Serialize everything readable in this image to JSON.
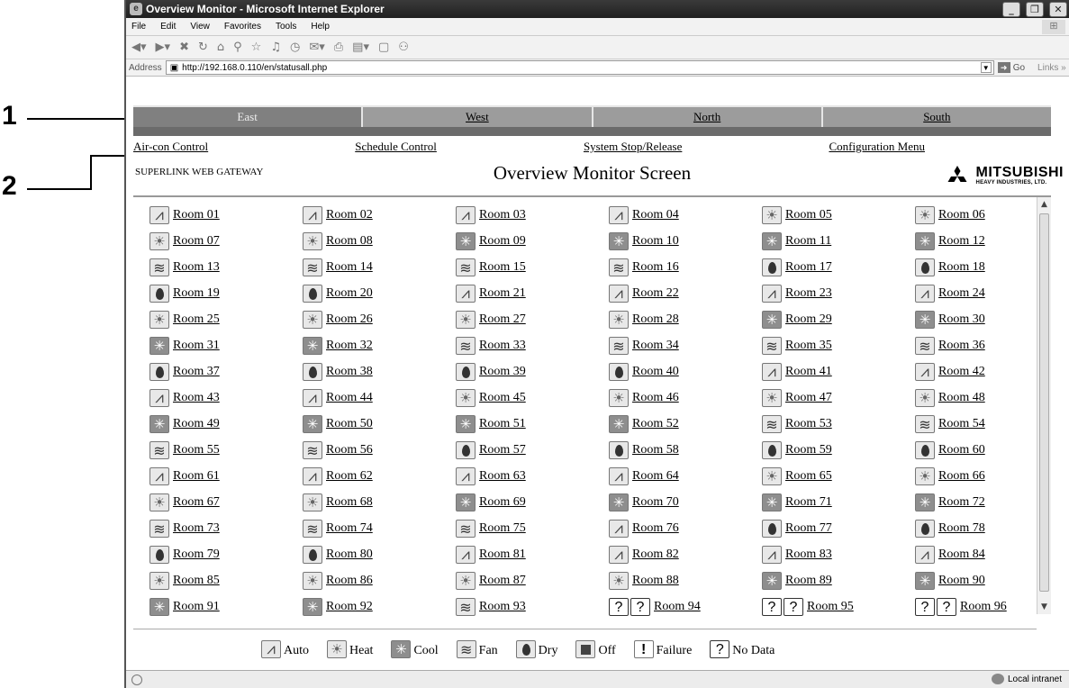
{
  "callouts": [
    "1",
    "2"
  ],
  "window": {
    "title": "Overview Monitor - Microsoft Internet Explorer",
    "menu": [
      "File",
      "Edit",
      "View",
      "Favorites",
      "Tools",
      "Help"
    ],
    "address_label": "Address",
    "url": "http://192.168.0.110/en/statusall.php",
    "go_label": "Go",
    "links_label": "Links",
    "status_zone": "Local intranet"
  },
  "nav": {
    "tabs": [
      "East",
      "West",
      "North",
      "South"
    ],
    "active_tab": "East",
    "menu_links": [
      "Air-con Control",
      "Schedule Control",
      "System Stop/Release",
      "Configuration Menu"
    ]
  },
  "header": {
    "gateway": "SUPERLINK WEB GATEWAY",
    "title": "Overview Monitor Screen",
    "logo_main": "MITSUBISHI",
    "logo_sub": "HEAVY INDUSTRIES, LTD."
  },
  "rooms": [
    {
      "name": "Room 01",
      "mode": "auto"
    },
    {
      "name": "Room 02",
      "mode": "auto"
    },
    {
      "name": "Room 03",
      "mode": "auto"
    },
    {
      "name": "Room 04",
      "mode": "auto"
    },
    {
      "name": "Room 05",
      "mode": "heat"
    },
    {
      "name": "Room 06",
      "mode": "heat"
    },
    {
      "name": "Room 07",
      "mode": "heat"
    },
    {
      "name": "Room 08",
      "mode": "heat"
    },
    {
      "name": "Room 09",
      "mode": "cool"
    },
    {
      "name": "Room 10",
      "mode": "cool"
    },
    {
      "name": "Room 11",
      "mode": "cool"
    },
    {
      "name": "Room 12",
      "mode": "cool"
    },
    {
      "name": "Room 13",
      "mode": "fan"
    },
    {
      "name": "Room 14",
      "mode": "fan"
    },
    {
      "name": "Room 15",
      "mode": "fan"
    },
    {
      "name": "Room 16",
      "mode": "fan"
    },
    {
      "name": "Room 17",
      "mode": "dry"
    },
    {
      "name": "Room 18",
      "mode": "dry"
    },
    {
      "name": "Room 19",
      "mode": "dry"
    },
    {
      "name": "Room 20",
      "mode": "dry"
    },
    {
      "name": "Room 21",
      "mode": "auto"
    },
    {
      "name": "Room 22",
      "mode": "auto"
    },
    {
      "name": "Room 23",
      "mode": "auto"
    },
    {
      "name": "Room 24",
      "mode": "auto"
    },
    {
      "name": "Room 25",
      "mode": "heat"
    },
    {
      "name": "Room 26",
      "mode": "heat"
    },
    {
      "name": "Room 27",
      "mode": "heat"
    },
    {
      "name": "Room 28",
      "mode": "heat"
    },
    {
      "name": "Room 29",
      "mode": "cool"
    },
    {
      "name": "Room 30",
      "mode": "cool"
    },
    {
      "name": "Room 31",
      "mode": "cool"
    },
    {
      "name": "Room 32",
      "mode": "cool"
    },
    {
      "name": "Room 33",
      "mode": "fan"
    },
    {
      "name": "Room 34",
      "mode": "fan"
    },
    {
      "name": "Room 35",
      "mode": "fan"
    },
    {
      "name": "Room 36",
      "mode": "fan"
    },
    {
      "name": "Room 37",
      "mode": "dry"
    },
    {
      "name": "Room 38",
      "mode": "dry"
    },
    {
      "name": "Room 39",
      "mode": "dry"
    },
    {
      "name": "Room 40",
      "mode": "dry"
    },
    {
      "name": "Room 41",
      "mode": "auto"
    },
    {
      "name": "Room 42",
      "mode": "auto"
    },
    {
      "name": "Room 43",
      "mode": "auto"
    },
    {
      "name": "Room 44",
      "mode": "auto"
    },
    {
      "name": "Room 45",
      "mode": "heat"
    },
    {
      "name": "Room 46",
      "mode": "heat"
    },
    {
      "name": "Room 47",
      "mode": "heat"
    },
    {
      "name": "Room 48",
      "mode": "heat"
    },
    {
      "name": "Room 49",
      "mode": "cool"
    },
    {
      "name": "Room 50",
      "mode": "cool"
    },
    {
      "name": "Room 51",
      "mode": "cool"
    },
    {
      "name": "Room 52",
      "mode": "cool"
    },
    {
      "name": "Room 53",
      "mode": "fan"
    },
    {
      "name": "Room 54",
      "mode": "fan"
    },
    {
      "name": "Room 55",
      "mode": "fan"
    },
    {
      "name": "Room 56",
      "mode": "fan"
    },
    {
      "name": "Room 57",
      "mode": "dry"
    },
    {
      "name": "Room 58",
      "mode": "dry"
    },
    {
      "name": "Room 59",
      "mode": "dry"
    },
    {
      "name": "Room 60",
      "mode": "dry"
    },
    {
      "name": "Room 61",
      "mode": "auto"
    },
    {
      "name": "Room 62",
      "mode": "auto"
    },
    {
      "name": "Room 63",
      "mode": "auto"
    },
    {
      "name": "Room 64",
      "mode": "auto"
    },
    {
      "name": "Room 65",
      "mode": "heat"
    },
    {
      "name": "Room 66",
      "mode": "heat"
    },
    {
      "name": "Room 67",
      "mode": "heat"
    },
    {
      "name": "Room 68",
      "mode": "heat"
    },
    {
      "name": "Room 69",
      "mode": "cool"
    },
    {
      "name": "Room 70",
      "mode": "cool"
    },
    {
      "name": "Room 71",
      "mode": "cool"
    },
    {
      "name": "Room 72",
      "mode": "cool"
    },
    {
      "name": "Room 73",
      "mode": "fan"
    },
    {
      "name": "Room 74",
      "mode": "fan"
    },
    {
      "name": "Room 75",
      "mode": "fan"
    },
    {
      "name": "Room 76",
      "mode": "auto"
    },
    {
      "name": "Room 77",
      "mode": "dry"
    },
    {
      "name": "Room 78",
      "mode": "dry"
    },
    {
      "name": "Room 79",
      "mode": "dry"
    },
    {
      "name": "Room 80",
      "mode": "dry"
    },
    {
      "name": "Room 81",
      "mode": "auto"
    },
    {
      "name": "Room 82",
      "mode": "auto"
    },
    {
      "name": "Room 83",
      "mode": "auto"
    },
    {
      "name": "Room 84",
      "mode": "auto"
    },
    {
      "name": "Room 85",
      "mode": "heat"
    },
    {
      "name": "Room 86",
      "mode": "heat"
    },
    {
      "name": "Room 87",
      "mode": "heat"
    },
    {
      "name": "Room 88",
      "mode": "heat"
    },
    {
      "name": "Room 89",
      "mode": "cool"
    },
    {
      "name": "Room 90",
      "mode": "cool"
    },
    {
      "name": "Room 91",
      "mode": "cool"
    },
    {
      "name": "Room 92",
      "mode": "cool"
    },
    {
      "name": "Room 93",
      "mode": "fan"
    },
    {
      "name": "Room 94",
      "mode": "nodata"
    },
    {
      "name": "Room 95",
      "mode": "nodata"
    },
    {
      "name": "Room 96",
      "mode": "nodata"
    }
  ],
  "legend": [
    {
      "mode": "auto",
      "label": "Auto"
    },
    {
      "mode": "heat",
      "label": "Heat"
    },
    {
      "mode": "cool",
      "label": "Cool"
    },
    {
      "mode": "fan",
      "label": "Fan"
    },
    {
      "mode": "dry",
      "label": "Dry"
    },
    {
      "mode": "off",
      "label": "Off"
    },
    {
      "mode": "failure",
      "label": "Failure"
    },
    {
      "mode": "nodata",
      "label": "No Data"
    }
  ],
  "icons": {
    "auto": "auto-mode-icon",
    "heat": "sun-icon",
    "cool": "snowflake-icon",
    "fan": "fan-icon",
    "dry": "droplet-icon",
    "off": "off-square-icon",
    "failure": "exclamation-icon",
    "nodata": "question-mark-icon"
  },
  "colors": {
    "nav_bar": "#9c9c9c",
    "nav_active": "#808080",
    "sub_bar": "#6b6b6b",
    "title_bar": "#2b2b2b"
  }
}
